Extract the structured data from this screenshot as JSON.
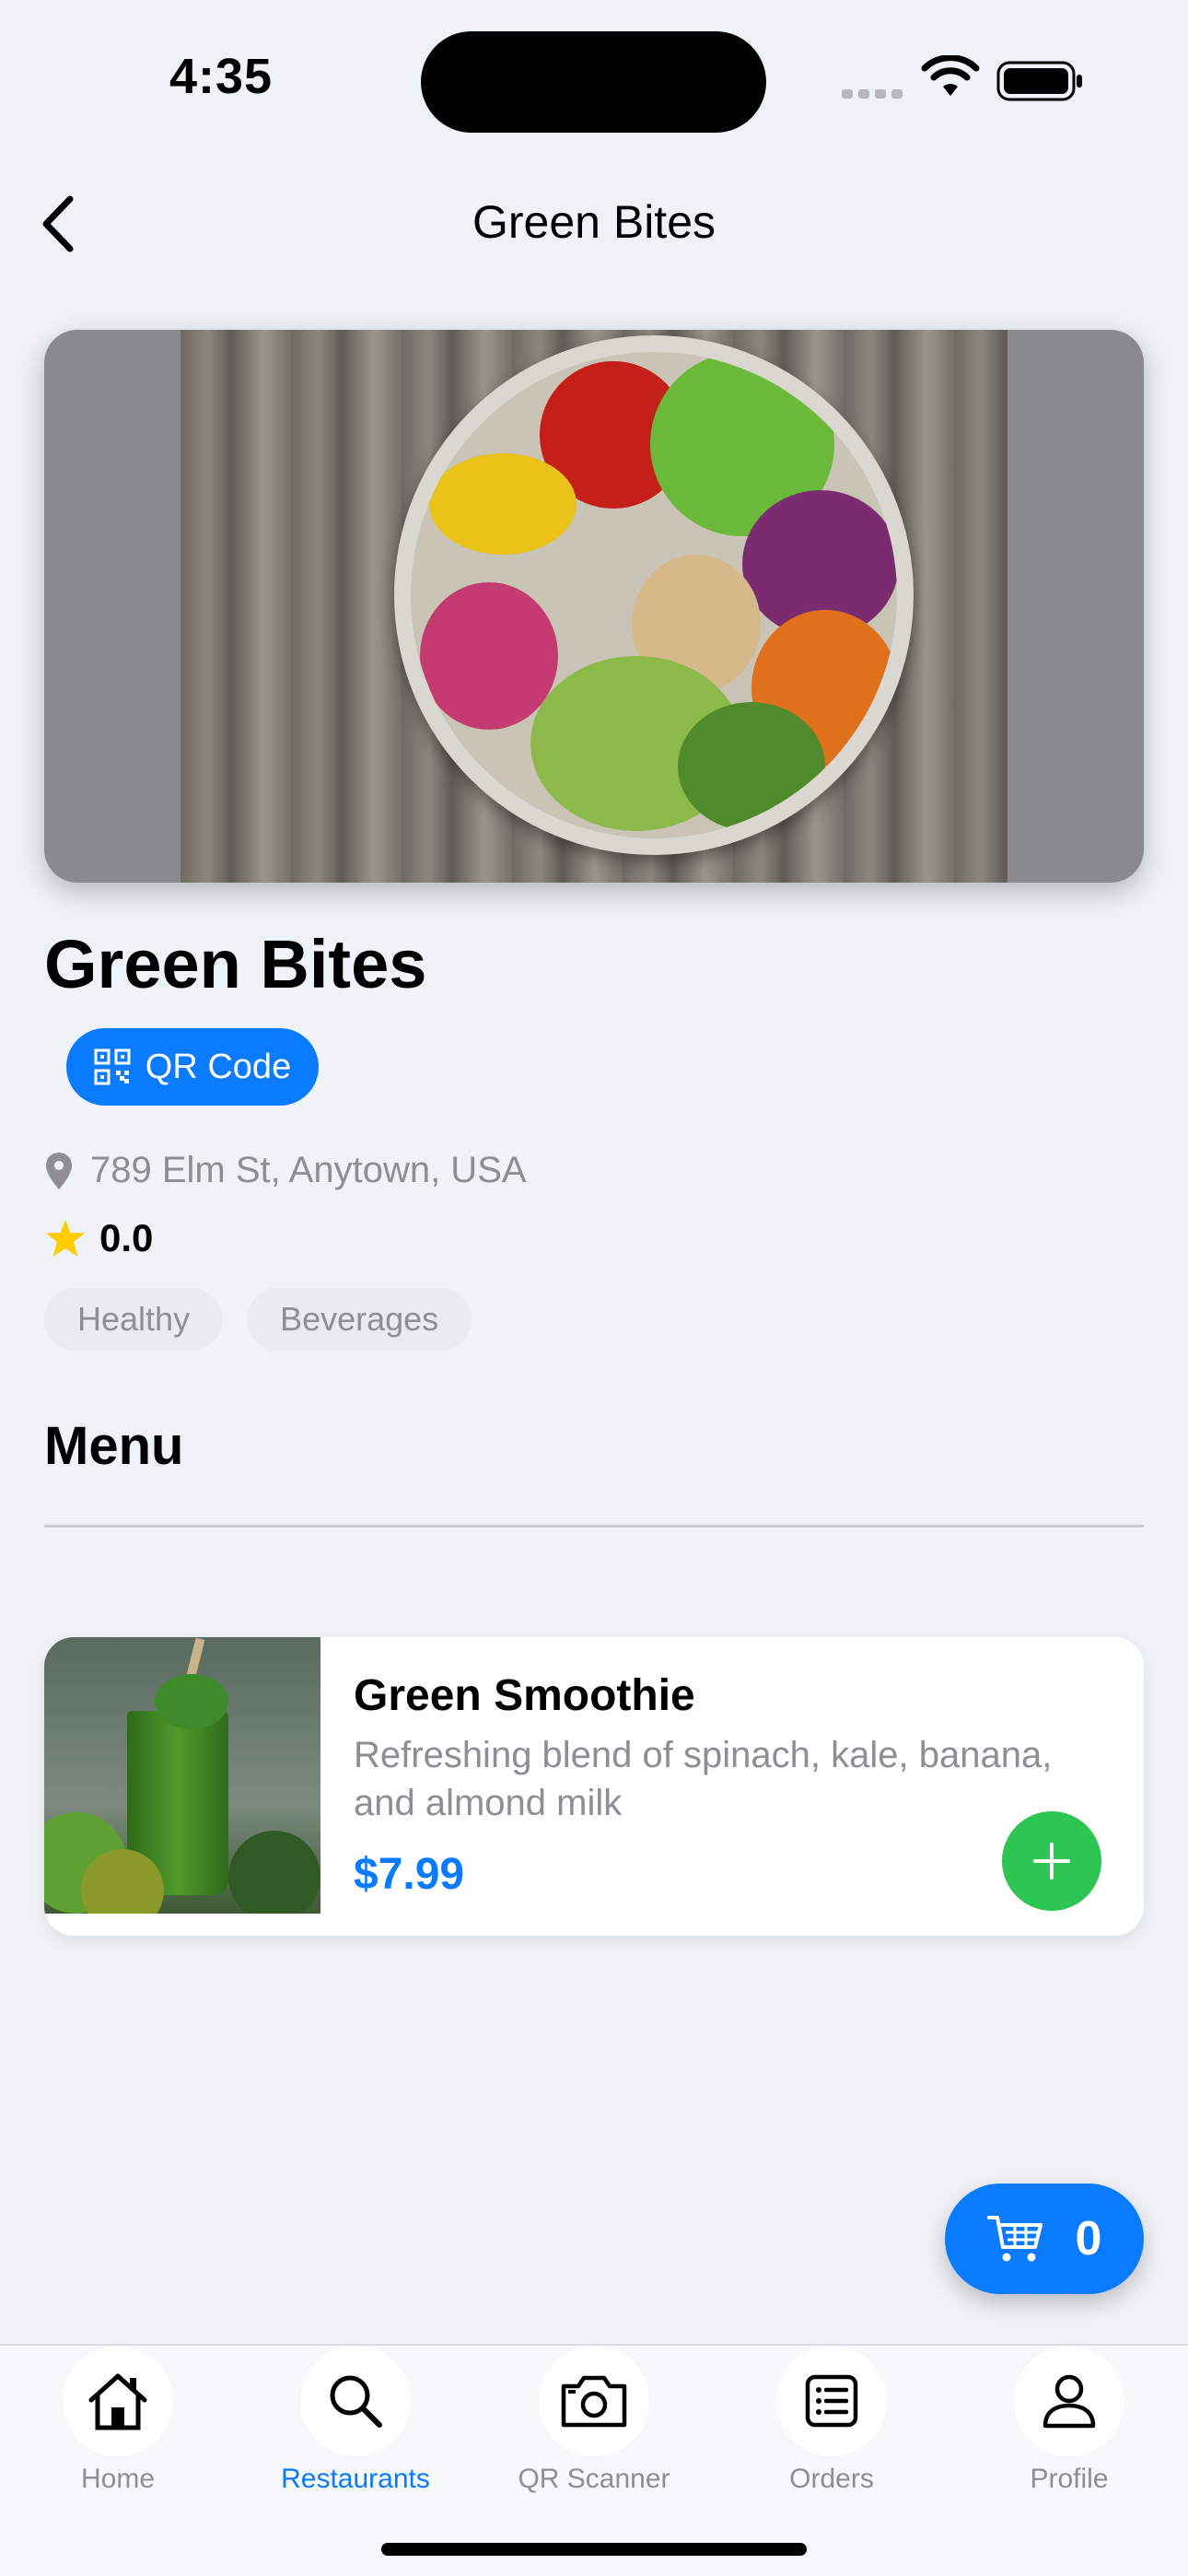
{
  "status": {
    "time": "4:35"
  },
  "nav": {
    "title": "Green Bites"
  },
  "restaurant": {
    "name": "Green Bites",
    "qr_label": "QR Code",
    "address": "789 Elm St, Anytown, USA",
    "rating": "0.0",
    "tags": [
      "Healthy",
      "Beverages"
    ]
  },
  "menu": {
    "title": "Menu",
    "items": [
      {
        "name": "Green Smoothie",
        "description": "Refreshing blend of spinach, kale, banana, and almond milk",
        "price": "$7.99"
      }
    ]
  },
  "cart": {
    "count": "0"
  },
  "tabs": [
    {
      "label": "Home",
      "icon": "home-icon"
    },
    {
      "label": "Restaurants",
      "icon": "search-icon"
    },
    {
      "label": "QR Scanner",
      "icon": "camera-icon"
    },
    {
      "label": "Orders",
      "icon": "list-icon"
    },
    {
      "label": "Profile",
      "icon": "person-icon"
    }
  ],
  "colors": {
    "accent": "#0a7bff",
    "add": "#2fc554",
    "star": "#ffcc00"
  }
}
